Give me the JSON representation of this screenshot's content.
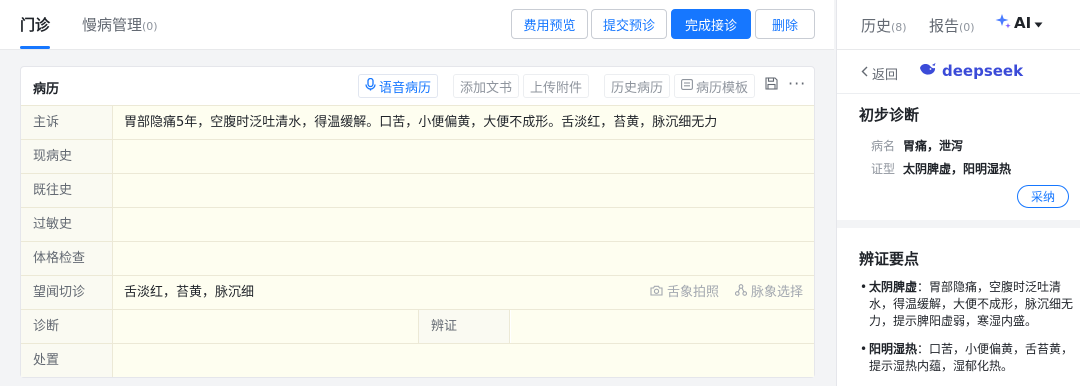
{
  "tabs": {
    "outpatient": "门诊",
    "chronic": "慢病管理",
    "chronic_count": "(0)"
  },
  "actions": {
    "fee_preview": "费用预览",
    "submit_preview": "提交预诊",
    "finish": "完成接诊",
    "delete": "删除"
  },
  "right_tabs": {
    "history": "历史",
    "history_count": "(8)",
    "report": "报告",
    "report_count": "(0)",
    "ai": "AI"
  },
  "right_panel": {
    "back": "返回",
    "brand": "deepseek",
    "initial_title": "初步诊断",
    "disease_key": "病名",
    "disease_val": "胃痛，泄泻",
    "syndrome_key": "证型",
    "syndrome_val": "太阴脾虚，阳明湿热",
    "adopt": "采纳",
    "points_title": "辨证要点",
    "point1_head": "太阴脾虚",
    "point1_body": "：胃部隐痛，空腹时泛吐清水，得温缓解，大便不成形，脉沉细无力，提示脾阳虚弱，寒湿内盛。",
    "point2_head": "阳明湿热",
    "point2_body": "：口苦，小便偏黄，舌苔黄，提示湿热内蕴，湿郁化热。"
  },
  "record": {
    "title": "病历",
    "voice": "语音病历",
    "add_doc": "添加文书",
    "upload": "上传附件",
    "history_record": "历史病历",
    "template": "病历模板",
    "rows": [
      {
        "label": "主诉",
        "value": "胃部隐痛5年，空腹时泛吐清水，得温缓解。口苦，小便偏黄，大便不成形。舌淡红，苔黄，脉沉细无力"
      },
      {
        "label": "现病史",
        "value": ""
      },
      {
        "label": "既往史",
        "value": ""
      },
      {
        "label": "过敏史",
        "value": ""
      },
      {
        "label": "体格检查",
        "value": ""
      },
      {
        "label": "望闻切诊",
        "value": "舌淡红，苔黄，脉沉细"
      },
      {
        "label": "诊断",
        "value": ""
      },
      {
        "label": "处置",
        "value": ""
      }
    ],
    "tongue_photo": "舌象拍照",
    "pulse_select": "脉象选择",
    "syndrome_label": "辨证"
  },
  "colors": {
    "accent": "#1677ff",
    "field_bg": "#fefef0"
  }
}
